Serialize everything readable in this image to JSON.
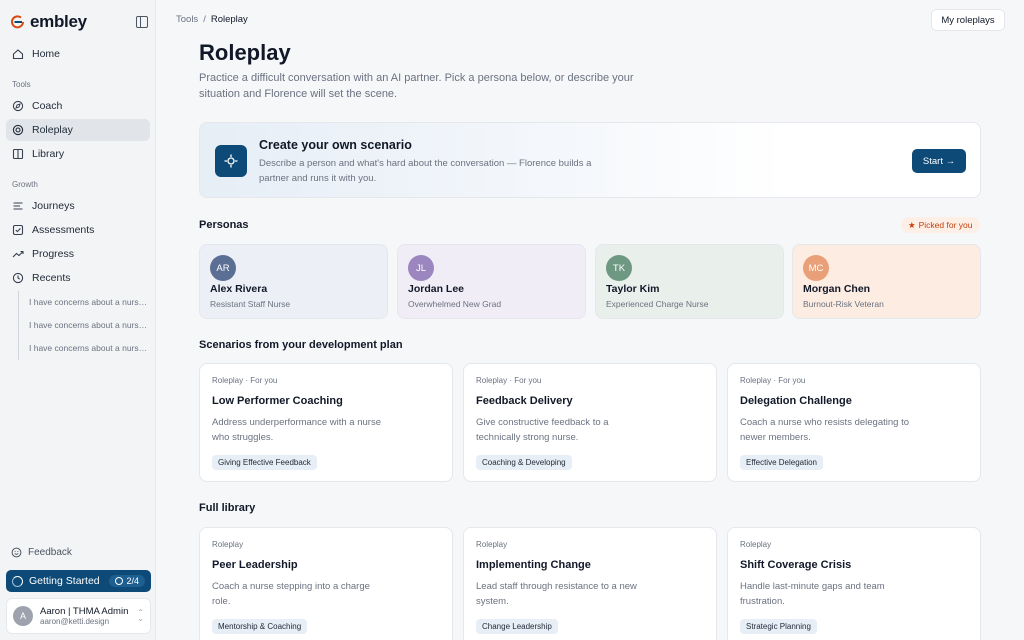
{
  "brand": {
    "name": "embley",
    "accent": "#0d4a78"
  },
  "sidebar": {
    "home": "Home",
    "tools_label": "Tools",
    "tools": [
      {
        "label": "Coach",
        "icon": "compass-icon"
      },
      {
        "label": "Roleplay",
        "icon": "target-icon",
        "active": true
      },
      {
        "label": "Library",
        "icon": "book-icon"
      }
    ],
    "growth_label": "Growth",
    "growth": [
      {
        "label": "Journeys",
        "icon": "list-icon"
      },
      {
        "label": "Assessments",
        "icon": "checkbox-icon"
      },
      {
        "label": "Progress",
        "icon": "trend-icon"
      },
      {
        "label": "Recents",
        "icon": "clock-icon"
      }
    ],
    "recents": [
      "I have concerns about a nurse…",
      "I have concerns about a nurse…",
      "I have concerns about a nurse…"
    ],
    "feedback": "Feedback",
    "getting_started": {
      "label": "Getting Started",
      "progress": "2/4"
    },
    "user": {
      "initial": "A",
      "name": "Aaron | THMA Admin",
      "email": "aaron@ketti.design"
    }
  },
  "breadcrumb": {
    "parent": "Tools",
    "sep": "/",
    "current": "Roleplay"
  },
  "header_button": "My roleplays",
  "page": {
    "title": "Roleplay",
    "description": "Practice a difficult conversation with an AI partner. Pick a persona below, or describe your situation and Florence will set the scene."
  },
  "create": {
    "title": "Create your own scenario",
    "description": "Describe a person and what's hard about the conversation — Florence builds a partner and runs it with you.",
    "button": "Start →"
  },
  "personas_section": {
    "title": "Personas",
    "picked": "Picked for you"
  },
  "personas": [
    {
      "initials": "AR",
      "name": "Alex Rivera",
      "role": "Resistant Staff Nurse",
      "avatar_color": "#5b6f95",
      "bg": "#eceff5"
    },
    {
      "initials": "JL",
      "name": "Jordan Lee",
      "role": "Overwhelmed New Grad",
      "avatar_color": "#9b86bf",
      "bg": "#f1edf6"
    },
    {
      "initials": "TK",
      "name": "Taylor Kim",
      "role": "Experienced Charge Nurse",
      "avatar_color": "#6f9882",
      "bg": "#e9efeb"
    },
    {
      "initials": "MC",
      "name": "Morgan Chen",
      "role": "Burnout-Risk Veteran",
      "avatar_color": "#e99f78",
      "bg": "#fcece2"
    }
  ],
  "dev_plan": {
    "title": "Scenarios from your development plan",
    "cards": [
      {
        "kicker": "Roleplay · For you",
        "title": "Low Performer Coaching",
        "desc": "Address underperformance with a nurse who struggles.",
        "tag": "Giving Effective Feedback"
      },
      {
        "kicker": "Roleplay · For you",
        "title": "Feedback Delivery",
        "desc": "Give constructive feedback to a technically strong nurse.",
        "tag": "Coaching & Developing"
      },
      {
        "kicker": "Roleplay · For you",
        "title": "Delegation Challenge",
        "desc": "Coach a nurse who resists delegating to newer members.",
        "tag": "Effective Delegation"
      }
    ]
  },
  "library": {
    "title": "Full library",
    "cards": [
      {
        "kicker": "Roleplay",
        "title": "Peer Leadership",
        "desc": "Coach a nurse stepping into a charge role.",
        "tag": "Mentorship & Coaching"
      },
      {
        "kicker": "Roleplay",
        "title": "Implementing Change",
        "desc": "Lead staff through resistance to a new system.",
        "tag": "Change Leadership"
      },
      {
        "kicker": "Roleplay",
        "title": "Shift Coverage Crisis",
        "desc": "Handle last-minute gaps and team frustration.",
        "tag": "Strategic Planning"
      }
    ]
  }
}
